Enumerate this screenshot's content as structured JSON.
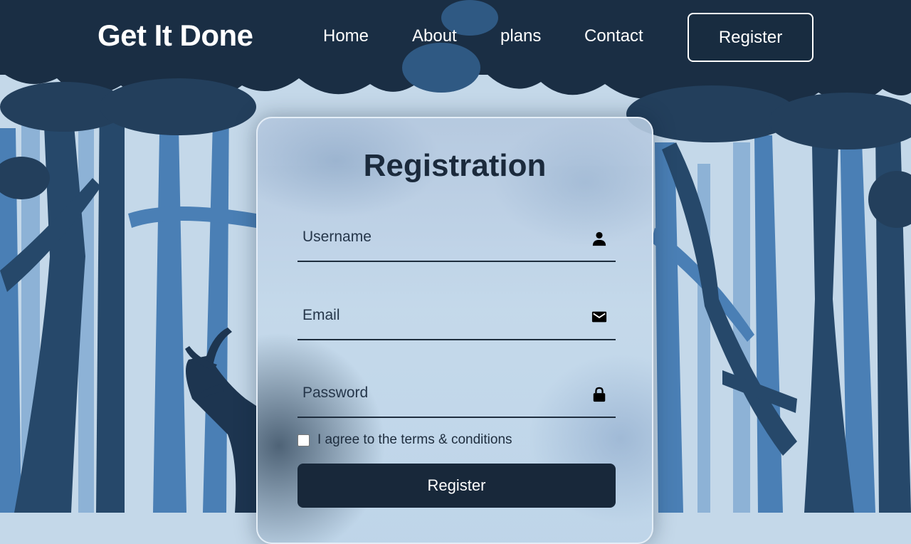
{
  "header": {
    "logo": "Get It Done",
    "nav": [
      "Home",
      "About",
      "plans",
      "Contact"
    ],
    "register_label": "Register"
  },
  "form": {
    "title": "Registration",
    "username": {
      "placeholder": "Username",
      "value": "",
      "icon": "user-icon"
    },
    "email": {
      "placeholder": "Email",
      "value": "",
      "icon": "mail-icon"
    },
    "password": {
      "placeholder": "Password",
      "value": "",
      "icon": "lock-icon"
    },
    "terms_label": "I agree to the terms & conditions",
    "terms_checked": false,
    "submit_label": "Register"
  },
  "colors": {
    "dark_navy": "#18283a",
    "sky": "#c4d8e9",
    "tree_mid": "#3f6d9e",
    "tree_dark": "#233f5c"
  }
}
